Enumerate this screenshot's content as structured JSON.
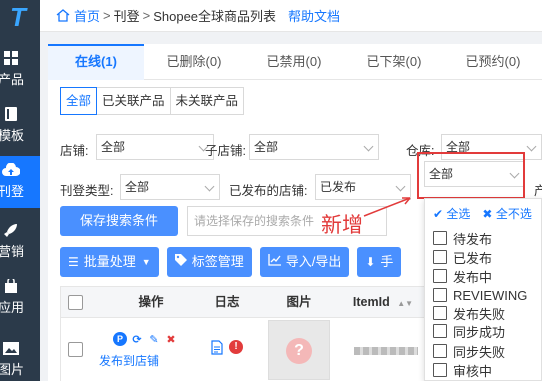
{
  "sidebar": {
    "logo": "T",
    "items": [
      {
        "label": "产品",
        "icon": "grid-icon"
      },
      {
        "label": "模板",
        "icon": "book-icon"
      },
      {
        "label": "刊登",
        "icon": "cloud-upload-icon"
      },
      {
        "label": "营销",
        "icon": "rocket-icon"
      },
      {
        "label": "应用",
        "icon": "bag-icon"
      },
      {
        "label": "图片",
        "icon": "image-icon"
      }
    ]
  },
  "breadcrumb": {
    "home": "首页",
    "level1": "刊登",
    "level2": "Shopee全球商品列表",
    "help": "帮助文档"
  },
  "tabs": [
    "在线(1)",
    "已删除(0)",
    "已禁用(0)",
    "已下架(0)",
    "已预约(0)"
  ],
  "link_filter": [
    "全部",
    "已关联产品",
    "未关联产品"
  ],
  "filters": {
    "store_label": "店铺:",
    "store_value": "全部",
    "substore_label": "子店铺:",
    "substore_value": "全部",
    "warehouse_label": "仓库:",
    "warehouse_value": "全部",
    "listing_type_label": "刊登类型:",
    "listing_type_value": "全部",
    "published_store_label": "已发布的店铺:",
    "published_store_value": "已发布",
    "status_value": "全部",
    "cut_label": "产"
  },
  "save_search": {
    "button": "保存搜索条件",
    "placeholder": "请选择保存的搜索条件"
  },
  "actions": {
    "batch": "批量处理",
    "tags": "标签管理",
    "import_export": "导入/导出",
    "more": "手"
  },
  "table": {
    "headers": {
      "op": "操作",
      "log": "日志",
      "image": "图片",
      "itemid": "ItemId"
    },
    "row": {
      "publish_link": "发布到店铺"
    }
  },
  "annotation": {
    "text": "新增"
  },
  "dropdown": {
    "select_all": "全选",
    "deselect_all": "全不选",
    "options": [
      "待发布",
      "已发布",
      "发布中",
      "REVIEWING",
      "发布失败",
      "同步成功",
      "同步失败",
      "审核中"
    ]
  },
  "colors": {
    "primary": "#1677ff",
    "sidebar": "#2b3a4a",
    "annotation": "#e23b3b"
  }
}
